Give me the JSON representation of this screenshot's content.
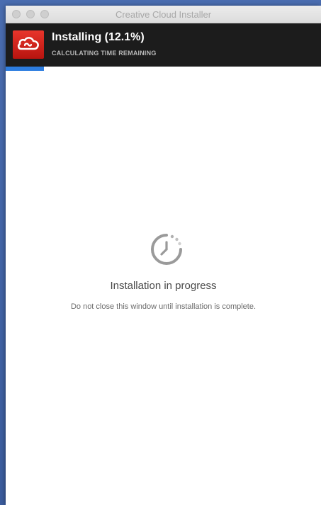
{
  "window": {
    "title": "Creative Cloud Installer"
  },
  "header": {
    "app_icon": "creative-cloud-icon",
    "status_title": "Installing (12.1%)",
    "status_subtitle": "CALCULATING TIME REMAINING"
  },
  "progress": {
    "percent": 12.1,
    "color": "#2d7de0"
  },
  "main": {
    "spinner_icon": "clock-spinner-icon",
    "message": "Installation in progress",
    "submessage": "Do not close this window until installation is complete."
  },
  "colors": {
    "brand_red": "#da1f26",
    "header_bg": "#1c1c1c"
  }
}
